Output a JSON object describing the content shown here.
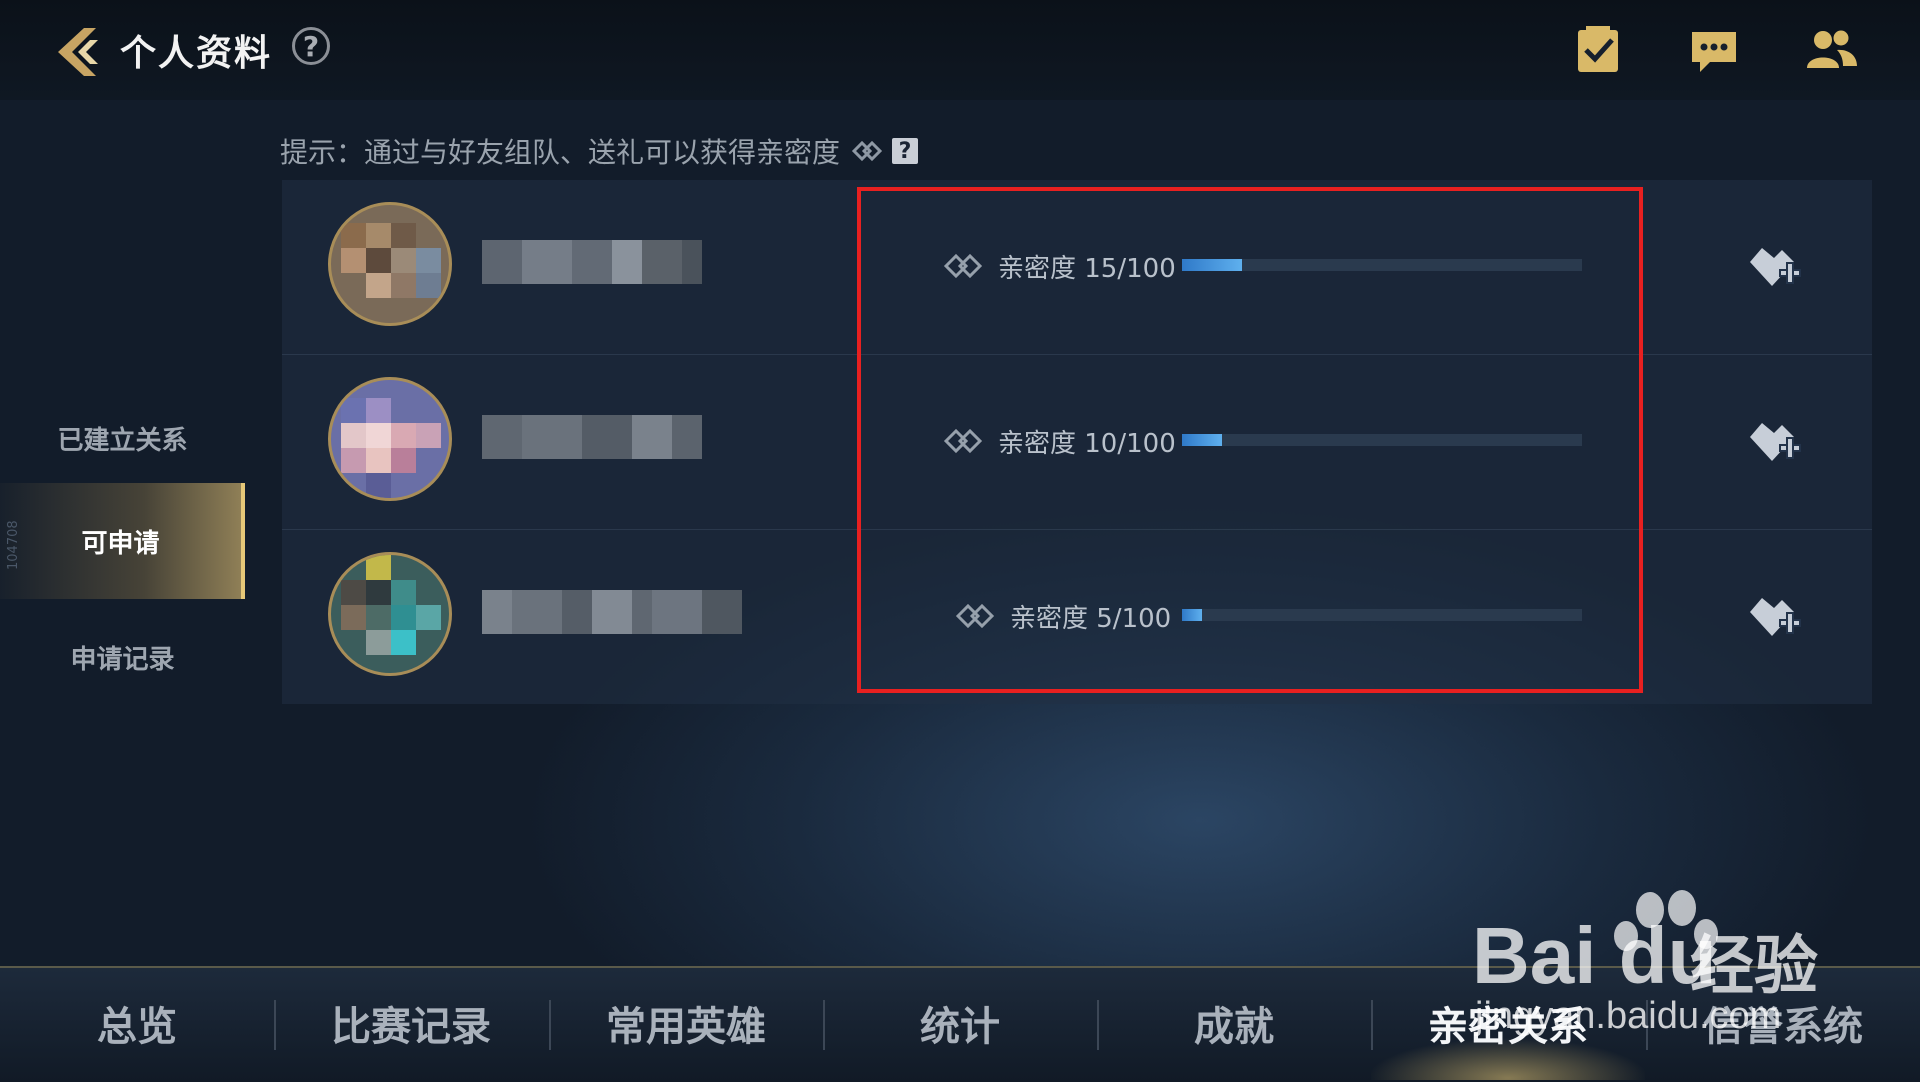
{
  "header": {
    "title": "个人资料",
    "help_label": "?"
  },
  "hint": {
    "text": "提示：通过与好友组队、送礼可以获得亲密度",
    "help_label": "?"
  },
  "sidebar": {
    "items": [
      {
        "label": "已建立关系",
        "active": false
      },
      {
        "label": "可申请",
        "active": true
      },
      {
        "label": "申请记录",
        "active": false
      }
    ],
    "vertical_text": "104708"
  },
  "friends": [
    {
      "intimacy_text": "亲密度 15/100",
      "intimacy_value": 15,
      "intimacy_max": 100
    },
    {
      "intimacy_text": "亲密度 10/100",
      "intimacy_value": 10,
      "intimacy_max": 100
    },
    {
      "intimacy_text": "亲密度 5/100",
      "intimacy_value": 5,
      "intimacy_max": 100
    }
  ],
  "tabs": [
    {
      "label": "总览",
      "active": false
    },
    {
      "label": "比赛记录",
      "active": false
    },
    {
      "label": "常用英雄",
      "active": false
    },
    {
      "label": "统计",
      "active": false
    },
    {
      "label": "成就",
      "active": false
    },
    {
      "label": "亲密关系",
      "active": true
    },
    {
      "label": "信誉系统",
      "active": false
    }
  ],
  "watermark": {
    "brand": "Bai du",
    "cn": "经验",
    "url": "jingyan.baidu.com"
  },
  "colors": {
    "accent_gold": "#e6c878",
    "highlight_red": "#e82020",
    "bar_blue": "#3b8ad6"
  }
}
